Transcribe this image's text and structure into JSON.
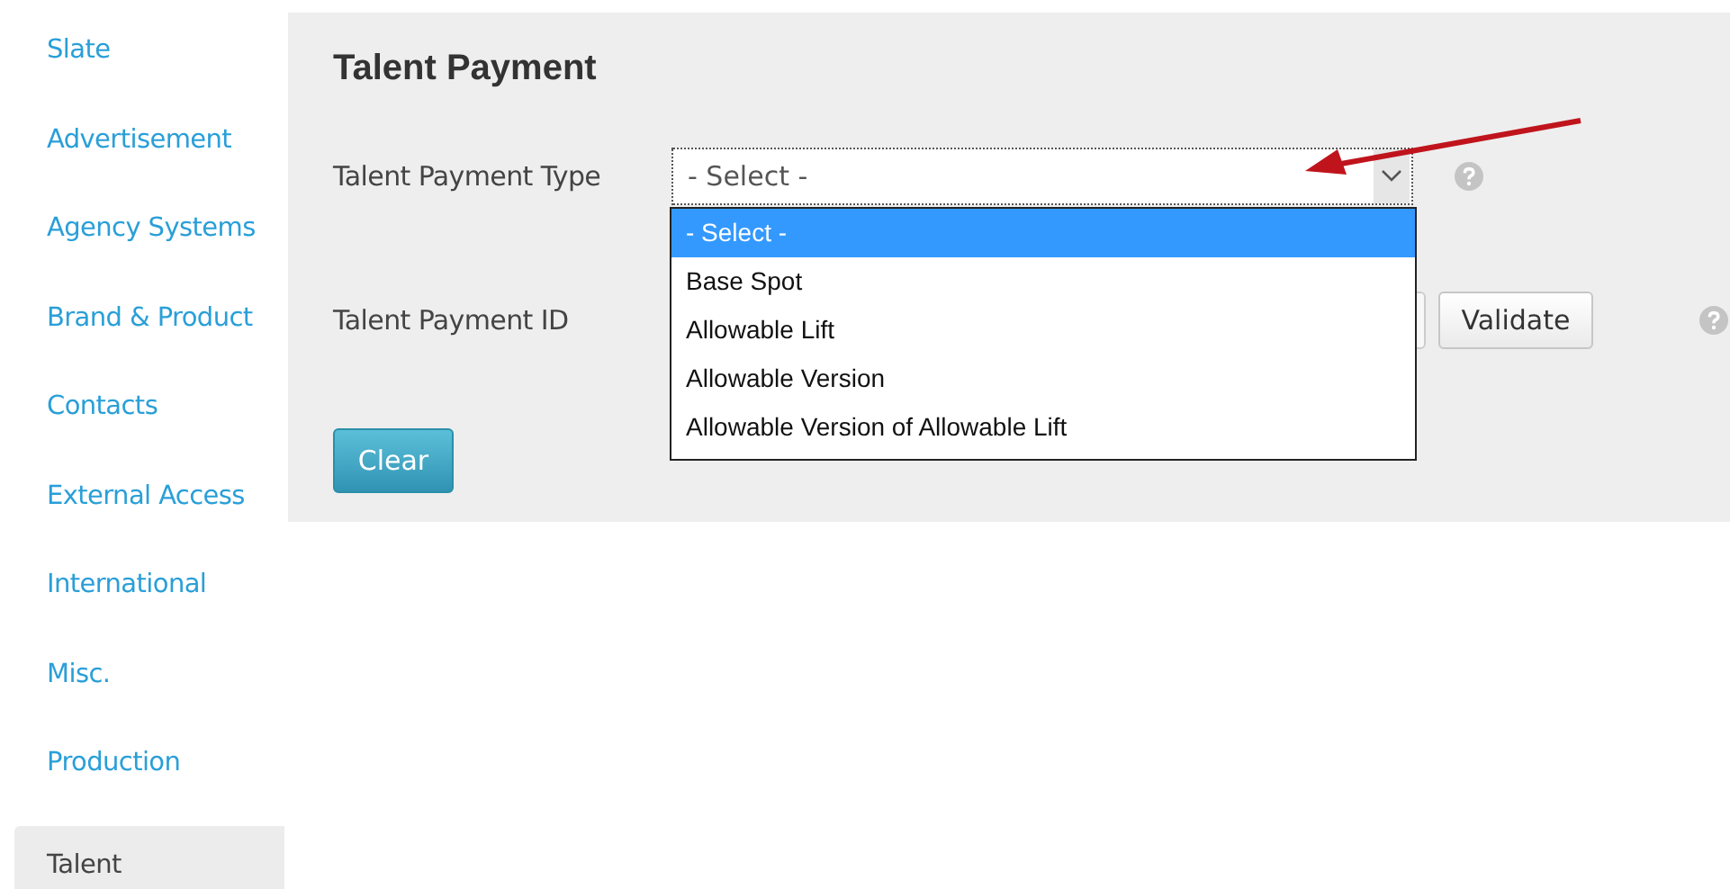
{
  "sidebar": {
    "items": [
      {
        "label": "Slate",
        "selected": false
      },
      {
        "label": "Advertisement",
        "selected": false
      },
      {
        "label": "Agency Systems",
        "selected": false
      },
      {
        "label": "Brand & Product",
        "selected": false
      },
      {
        "label": "Contacts",
        "selected": false
      },
      {
        "label": "External Access",
        "selected": false
      },
      {
        "label": "International",
        "selected": false
      },
      {
        "label": "Misc.",
        "selected": false
      },
      {
        "label": "Production",
        "selected": false
      },
      {
        "label": "Talent",
        "selected": true
      }
    ]
  },
  "panel": {
    "title": "Talent Payment",
    "payment_type": {
      "label": "Talent Payment Type",
      "value": "- Select -",
      "expanded": true,
      "options": [
        {
          "label": "- Select -",
          "selected": true
        },
        {
          "label": "Base Spot",
          "selected": false
        },
        {
          "label": "Allowable Lift",
          "selected": false
        },
        {
          "label": "Allowable Version",
          "selected": false
        },
        {
          "label": "Allowable Version of Allowable Lift",
          "selected": false
        }
      ]
    },
    "payment_id": {
      "label": "Talent Payment ID",
      "button": "Validate"
    },
    "clear_button": "Clear"
  }
}
